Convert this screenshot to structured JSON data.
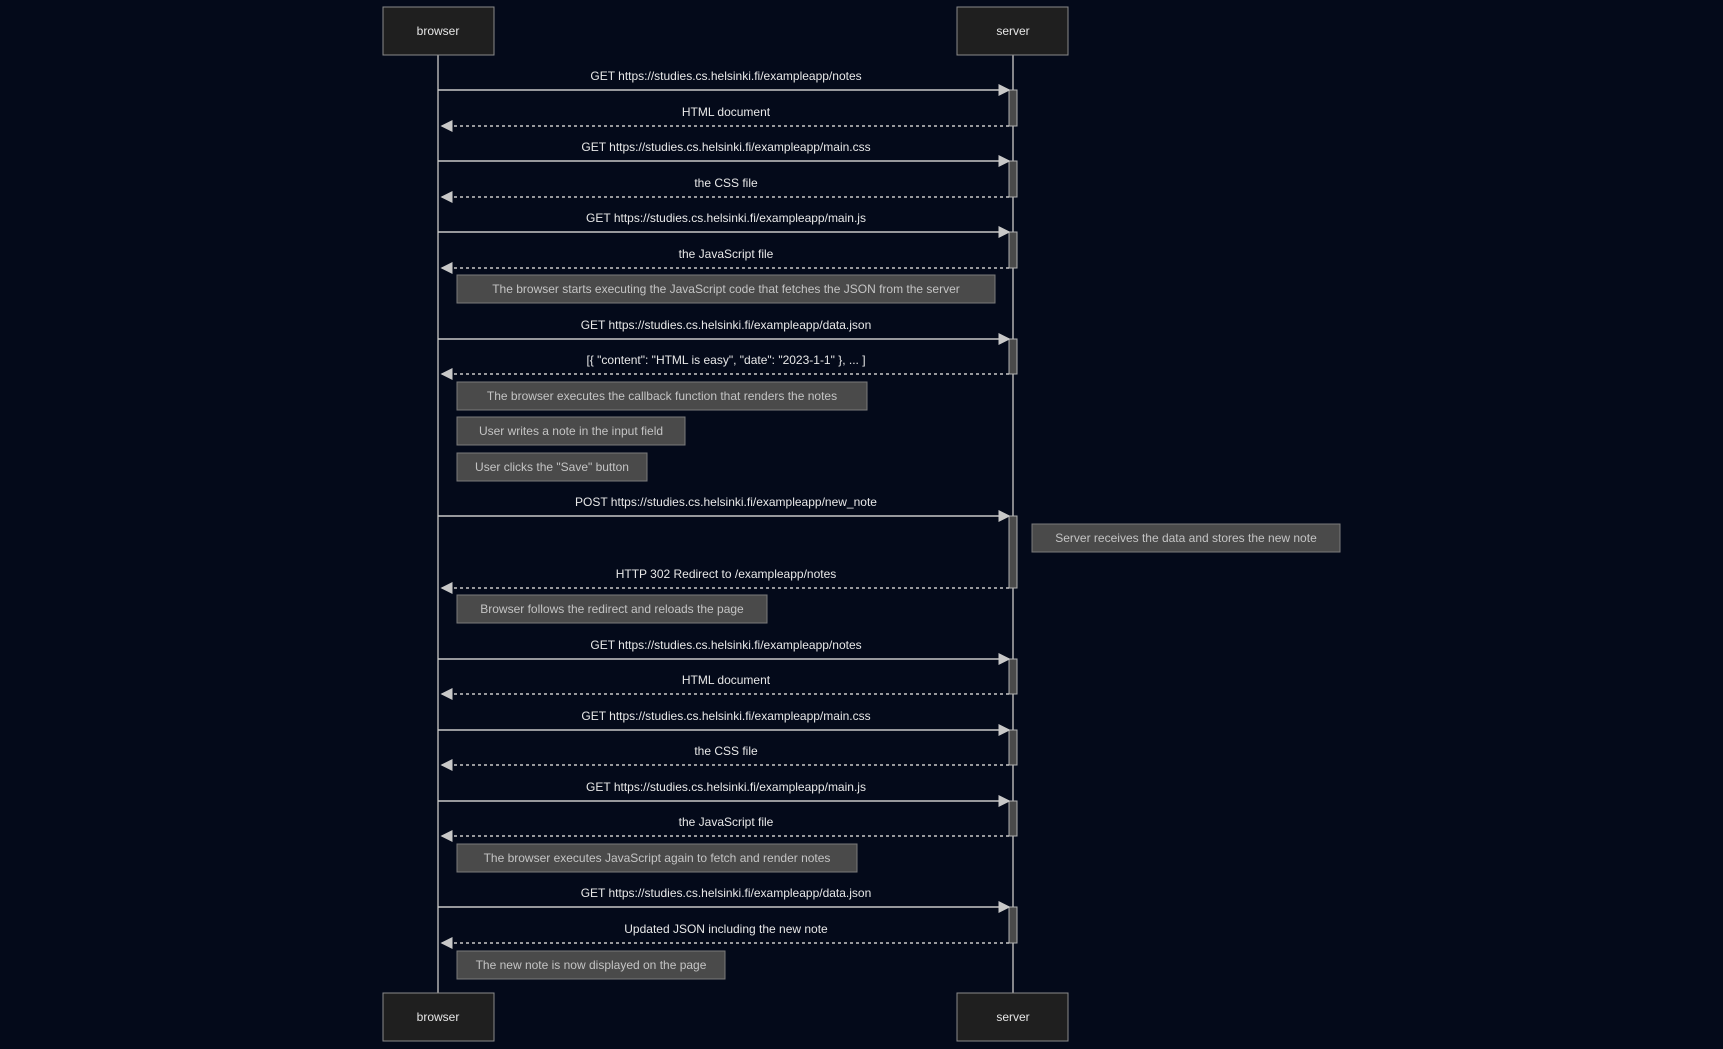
{
  "participants": {
    "browser": "browser",
    "server": "server"
  },
  "messages": [
    {
      "type": "request",
      "text": "GET https://studies.cs.helsinki.fi/exampleapp/notes"
    },
    {
      "type": "response",
      "text": "HTML document"
    },
    {
      "type": "request",
      "text": "GET https://studies.cs.helsinki.fi/exampleapp/main.css"
    },
    {
      "type": "response",
      "text": "the CSS file"
    },
    {
      "type": "request",
      "text": "GET https://studies.cs.helsinki.fi/exampleapp/main.js"
    },
    {
      "type": "response",
      "text": "the JavaScript file"
    },
    {
      "type": "note",
      "text": "The browser starts executing the JavaScript code that fetches the JSON from the server"
    },
    {
      "type": "request",
      "text": "GET https://studies.cs.helsinki.fi/exampleapp/data.json"
    },
    {
      "type": "response",
      "text": "[{ \"content\": \"HTML is easy\", \"date\": \"2023-1-1\" }, ... ]"
    },
    {
      "type": "note",
      "text": "The browser executes the callback function that renders the notes"
    },
    {
      "type": "note",
      "text": "User writes a note in the input field"
    },
    {
      "type": "note",
      "text": "User clicks the \"Save\" button"
    },
    {
      "type": "request",
      "text": "POST https://studies.cs.helsinki.fi/exampleapp/new_note"
    },
    {
      "type": "server-note",
      "text": "Server receives the data and stores the new note"
    },
    {
      "type": "response",
      "text": "HTTP 302 Redirect to /exampleapp/notes"
    },
    {
      "type": "note",
      "text": "Browser follows the redirect and reloads the page"
    },
    {
      "type": "request",
      "text": "GET https://studies.cs.helsinki.fi/exampleapp/notes"
    },
    {
      "type": "response",
      "text": "HTML document"
    },
    {
      "type": "request",
      "text": "GET https://studies.cs.helsinki.fi/exampleapp/main.css"
    },
    {
      "type": "response",
      "text": "the CSS file"
    },
    {
      "type": "request",
      "text": "GET https://studies.cs.helsinki.fi/exampleapp/main.js"
    },
    {
      "type": "response",
      "text": "the JavaScript file"
    },
    {
      "type": "note",
      "text": "The browser executes JavaScript again to fetch and render notes"
    },
    {
      "type": "request",
      "text": "GET https://studies.cs.helsinki.fi/exampleapp/data.json"
    },
    {
      "type": "response",
      "text": "Updated JSON including the new note"
    },
    {
      "type": "note",
      "text": "The new note is now displayed on the page"
    }
  ]
}
